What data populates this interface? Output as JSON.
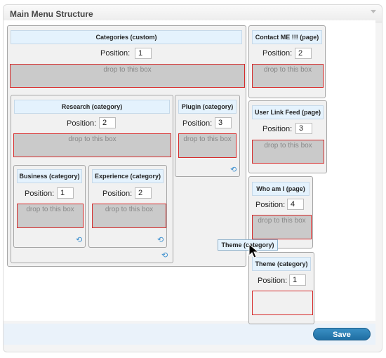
{
  "panel": {
    "title": "Main Menu Structure"
  },
  "footer": {
    "save_label": "Save"
  },
  "position_label": "Position:",
  "drop_text": "drop to this box",
  "boxes": {
    "categories": {
      "title": "Categories (custom)",
      "position": "1"
    },
    "research": {
      "title": "Research (category)",
      "position": "2"
    },
    "plugin": {
      "title": "Plugin (category)",
      "position": "3"
    },
    "business": {
      "title": "Business (category)",
      "position": "1"
    },
    "experience": {
      "title": "Experience (category)",
      "position": "2"
    },
    "contact": {
      "title": "Contact ME !!! (page)",
      "position": "2"
    },
    "userlink": {
      "title": "User Link Feed (page)",
      "position": "3"
    },
    "whoami": {
      "title": "Who am I (page)",
      "position": "4"
    },
    "theme": {
      "title": "Theme (category)",
      "position": "1"
    }
  },
  "dragging": {
    "label": "Theme (category)"
  },
  "icons": {
    "refresh": "refresh-icon",
    "cursor": "arrow-cursor-icon",
    "collapse": "triangle-down-icon"
  },
  "colors": {
    "title_bg": "#e4f2fd",
    "drop_border": "#d62a2a",
    "save_bg": "#2a7db5"
  }
}
